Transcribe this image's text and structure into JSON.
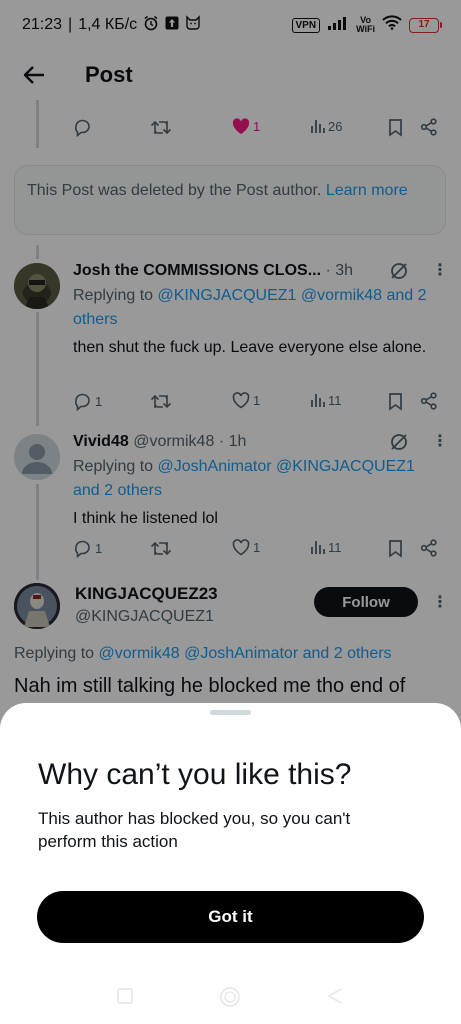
{
  "status_bar": {
    "time": "21:23",
    "speed": "1,4 КБ/с",
    "vpn": "VPN",
    "vowifi_top": "Vo",
    "vowifi_bottom": "WiFi",
    "battery": "17"
  },
  "header": {
    "title": "Post"
  },
  "first_post_actions": {
    "likes": "1",
    "views": "26"
  },
  "deleted_notice": {
    "text": "This Post was deleted by the Post author.",
    "link": "Learn more"
  },
  "replies": [
    {
      "name": "Josh the COMMISSIONS CLOS...",
      "time": "· 3h",
      "replying_prefix": "Replying to",
      "replying_to": "@KINGJACQUEZ1 @vormik48 and 2 others",
      "text": "then shut the fuck up. Leave everyone else alone.",
      "replies_count": "1",
      "likes": "1",
      "views": "11"
    },
    {
      "name": "Vivid48",
      "handle": "@vormik48",
      "time": "· 1h",
      "replying_prefix": "Replying to",
      "replying_to": "@JoshAnimator @KINGJACQUEZ1 and 2 others",
      "text": "I think he listened lol",
      "replies_count": "1",
      "likes": "1",
      "views": "11"
    }
  ],
  "focused_post": {
    "name": "KINGJACQUEZ23",
    "handle": "@KINGJACQUEZ1",
    "follow_label": "Follow",
    "replying_prefix": "Replying to",
    "replying_to": "@vormik48 @JoshAnimator and 2 others",
    "text": "Nah im still talking he blocked me tho end of"
  },
  "sheet": {
    "title": "Why can’t you like this?",
    "description": "This author has blocked you, so you can't perform this action",
    "button": "Got it"
  },
  "colors": {
    "accent": "#1d9bf0",
    "like": "#f91880",
    "text": "#0f1419",
    "muted": "#536471"
  }
}
